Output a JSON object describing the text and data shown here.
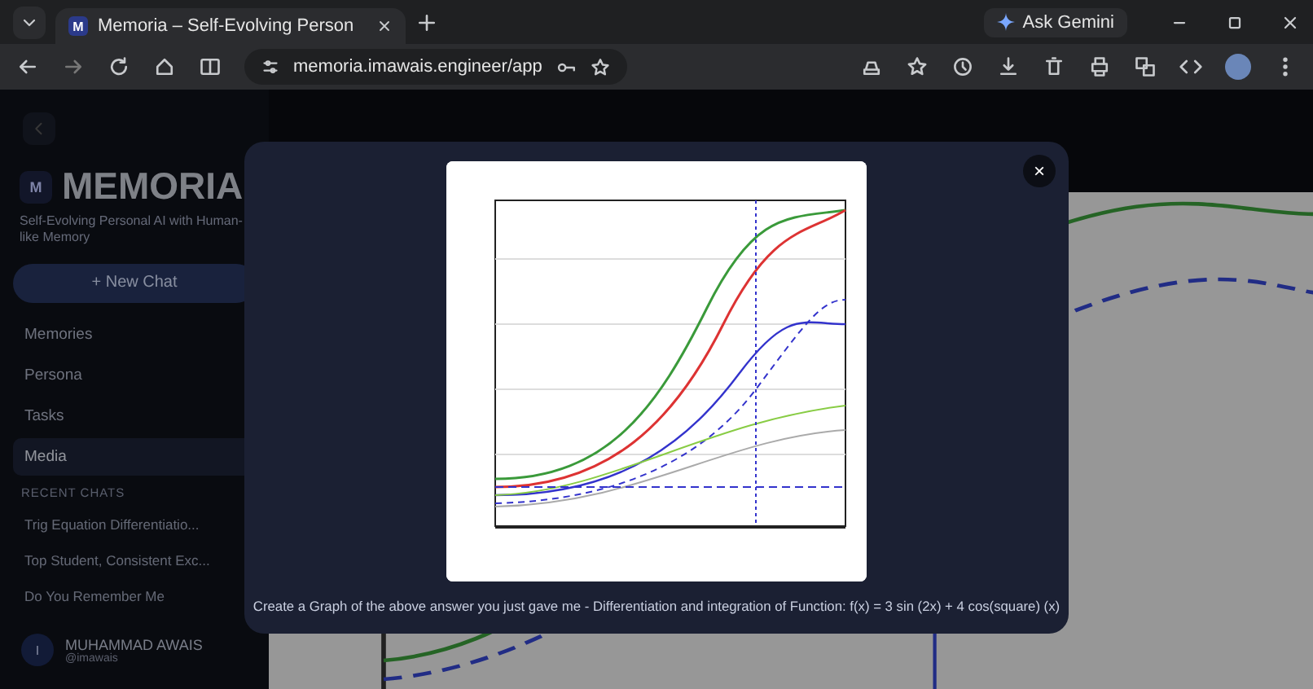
{
  "browser": {
    "tabs": [
      {
        "title": "Memoria – Self-Evolving Person",
        "favicon": "M",
        "selected": true
      }
    ],
    "ask_gemini": "Ask Gemini",
    "address": "memoria.imawais.engineer/app"
  },
  "sidebar": {
    "logo": "M",
    "brand": "MEMORIA",
    "tagline": "Self-Evolving Personal AI with Human-like Memory",
    "new_chat": "+ New Chat",
    "nav": [
      {
        "label": "Memories",
        "selected": false
      },
      {
        "label": "Persona",
        "selected": false
      },
      {
        "label": "Tasks",
        "selected": false
      },
      {
        "label": "Media",
        "selected": true
      }
    ],
    "recent_heading": "RECENT CHATS",
    "recent_chats": [
      "Trig Equation Differentiatio...",
      "Top Student, Consistent Exc...",
      "Do You Remember Me"
    ],
    "user": {
      "initial": "I",
      "name": "MUHAMMAD AWAIS",
      "handle": "@imawais"
    }
  },
  "modal": {
    "close": "×",
    "caption": "Create a Graph of the above answer you just gave me - Differentiation and integration of Function: f(x) = 3 sin (2x) + 4 cos(square) (x)"
  }
}
